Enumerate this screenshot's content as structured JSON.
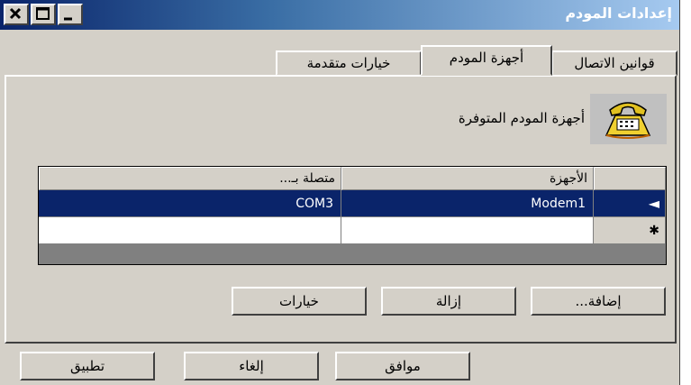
{
  "window": {
    "title": "إعدادات المودم"
  },
  "tabs": [
    {
      "label": "قوانين الاتصال"
    },
    {
      "label": "أجهزة المودم"
    },
    {
      "label": "خيارات متقدمة"
    }
  ],
  "main": {
    "available_label": "أجهزة المودم المتوفرة",
    "icon": "telephone-icon",
    "grid": {
      "columns": [
        "الأجهزة",
        "متصلة بـ..."
      ],
      "rows": [
        {
          "indicator": "◄",
          "device": "Modem1",
          "port": "COM3",
          "selected": true
        },
        {
          "indicator": "✱",
          "device": "",
          "port": "",
          "selected": false
        }
      ]
    },
    "buttons": {
      "add": "إضافة...",
      "remove": "إزالة",
      "options": "خيارات"
    }
  },
  "footer": {
    "ok": "موافق",
    "cancel": "إلغاء",
    "apply": "تطبيق"
  },
  "colors": {
    "titlebar_start": "#0a246a",
    "titlebar_end": "#a6caf0",
    "selection": "#0a246a",
    "face": "#d4d0c8"
  }
}
